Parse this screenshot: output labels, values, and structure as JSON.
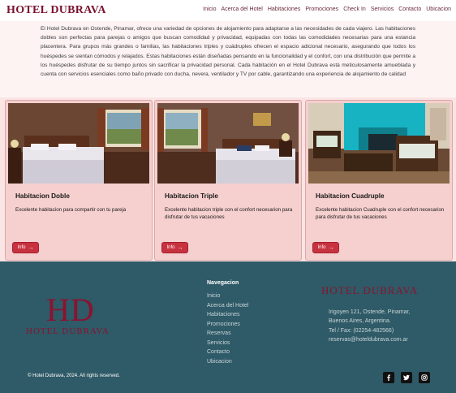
{
  "header": {
    "brand": "HOTEL DUBRAVA",
    "nav": [
      "Inicio",
      "Acerca del Hotel",
      "Habitaciones",
      "Promociones",
      "Check In",
      "Servicios",
      "Contacto",
      "Ubicacion"
    ]
  },
  "intro": {
    "text": "El Hotel Dubrava en Ostende, Pinamar, ofrece una variedad de opciones de alojamiento para adaptarse a las necesidades de cada viajero. Las habitaciones dobles son perfectas para parejas o amigos que buscan comodidad y privacidad, equipadas con todas las comodidades necesarias para una estancia placentera. Para grupos más grandes o familias, las habitaciones triples y cuádruples ofrecen el espacio adicional necesario, asegurando que todos los huéspedes se sientan cómodos y relajados. Estas habitaciones están diseñadas pensando en la funcionalidad y el confort, con una distribución que permite a los huéspedes disfrutar de su tiempo juntos sin sacrificar la privacidad personal. Cada habitación en el Hotel Dubrava está meticulosamente amueblada y cuenta con servicios esenciales como baño privado con ducha, nevera, ventilador y TV por cable, garantizando una experiencia de alojamiento de calidad"
  },
  "rooms": [
    {
      "title": "Habitacion Doble",
      "description": "Excelente habitacion para compartir con tu pareja",
      "button": "Info",
      "icon": "arrow-right-icon"
    },
    {
      "title": "Habitacion Triple",
      "description": "Excelente habitacion triple con el confort necesarion para disfrutar de tus vacaciones",
      "button": "Info",
      "icon": "arrow-right-icon"
    },
    {
      "title": "Habitacion Cuadruple",
      "description": "Excelente habitacion Cuadruple con el confort necesarion para disfrutar de tus vacaciones",
      "button": "Info",
      "icon": "arrow-right-icon"
    }
  ],
  "footer": {
    "logo_initials": "HD",
    "logo_text": "HOTEL DUBRAVA",
    "nav_title": "Navegacion",
    "links": [
      "Inicio",
      "Acerca del Hotel",
      "Habitaciones",
      "Promociones",
      "Reservas",
      "Servicios",
      "Contacto",
      "Ubicacion"
    ],
    "brand": "HOTEL DUBRAVA",
    "contact": {
      "address": "Irigoyen 121, Ostende, Pinamar,",
      "city": "Buenos Aires, Argentina.",
      "phone": "Tel / Fax: (02254-482566)",
      "email": "reservas@hoteldubrava.com.ar"
    },
    "copyright": "© Hotel Dubrava, 2024. All rights reserved.",
    "social": [
      "facebook-icon",
      "twitter-icon",
      "instagram-icon"
    ]
  },
  "colors": {
    "brand": "#7a1230",
    "footer_bg": "#2f5a67",
    "card_bg": "#f6cfcf",
    "button": "#c8323f"
  }
}
